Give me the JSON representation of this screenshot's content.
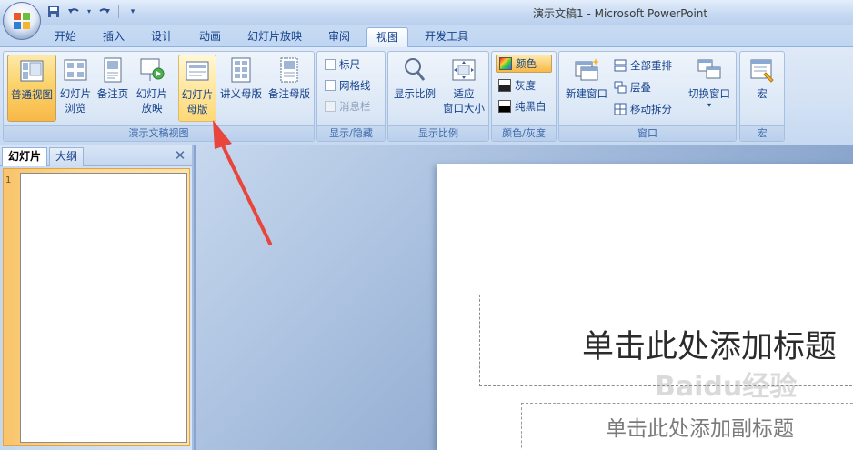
{
  "window": {
    "title": "演示文稿1 - Microsoft PowerPoint"
  },
  "tabs": [
    {
      "label": "开始"
    },
    {
      "label": "插入"
    },
    {
      "label": "设计"
    },
    {
      "label": "动画"
    },
    {
      "label": "幻灯片放映"
    },
    {
      "label": "审阅"
    },
    {
      "label": "视图",
      "active": true
    },
    {
      "label": "开发工具"
    }
  ],
  "ribbon": {
    "views": {
      "label": "演示文稿视图",
      "normal": "普通视图",
      "sorter": [
        "幻灯片",
        "浏览"
      ],
      "notes": "备注页",
      "show": [
        "幻灯片",
        "放映"
      ],
      "slide_master": [
        "幻灯片",
        "母版"
      ],
      "handout_master": "讲义母版",
      "notes_master": "备注母版"
    },
    "showhide": {
      "label": "显示/隐藏",
      "ruler": "标尺",
      "gridlines": "网格线",
      "messagebar": "消息栏"
    },
    "zoom": {
      "label": "显示比例",
      "zoom": "显示比例",
      "fit": [
        "适应",
        "窗口大小"
      ]
    },
    "color": {
      "label": "颜色/灰度",
      "color": "颜色",
      "grayscale": "灰度",
      "bw": "纯黑白"
    },
    "window": {
      "label": "窗口",
      "new_window": "新建窗口",
      "arrange_all": "全部重排",
      "cascade": "层叠",
      "move_split": "移动拆分",
      "switch": "切换窗口"
    },
    "macros": {
      "label": "宏",
      "macros": "宏"
    }
  },
  "panel": {
    "tab_slides": "幻灯片",
    "tab_outline": "大纲",
    "close": "✕",
    "slide_number": "1"
  },
  "slide": {
    "title_placeholder": "单击此处添加标题",
    "subtitle_placeholder": "单击此处添加副标题"
  },
  "watermark": "Baidu经验",
  "colors": {
    "accent_selected": "#f8b848",
    "ribbon_text": "#15428b",
    "arrow": "#e8453c"
  }
}
